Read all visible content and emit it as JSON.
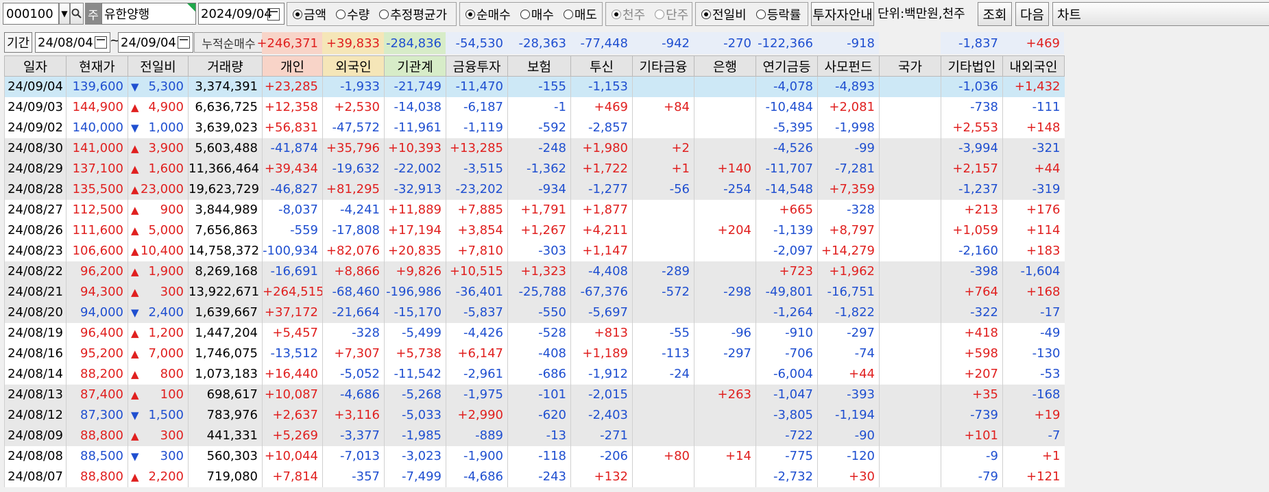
{
  "toolbar": {
    "code": "000100",
    "market_badge": "주",
    "stock_name": "유한양행",
    "date": "2024/09/04",
    "group1": [
      {
        "label": "금액",
        "on": true
      },
      {
        "label": "수량",
        "on": false
      },
      {
        "label": "추정평균가",
        "on": false
      }
    ],
    "group2": [
      {
        "label": "순매수",
        "on": true
      },
      {
        "label": "매수",
        "on": false
      },
      {
        "label": "매도",
        "on": false
      }
    ],
    "group3": [
      {
        "label": "천주",
        "on": true
      },
      {
        "label": "단주",
        "on": false
      }
    ],
    "group4": [
      {
        "label": "전일비",
        "on": true
      },
      {
        "label": "등락률",
        "on": false
      }
    ],
    "investor_btn": "투자자안내",
    "unit": "단위:백만원,천주",
    "search_btn": "조회",
    "next_btn": "다음",
    "chart_btn": "차트"
  },
  "period": {
    "label": "기간",
    "start": "24/08/04",
    "tilde": "~",
    "end": "24/09/04",
    "cum_label": "누적순매수",
    "sums": [
      "+246,371",
      "+39,833",
      "-284,836",
      "-54,530",
      "-28,363",
      "-77,448",
      "-942",
      "-270",
      "-122,366",
      "-918",
      "",
      "-1,837",
      "+469"
    ]
  },
  "columns": [
    "일자",
    "현재가",
    "전일비",
    "거래량",
    "개인",
    "외국인",
    "기관계",
    "금융투자",
    "보험",
    "투신",
    "기타금융",
    "은행",
    "연기금등",
    "사모펀드",
    "국가",
    "기타법인",
    "내외국인"
  ],
  "rows": [
    {
      "d": "24/09/04",
      "p": "139,600",
      "dir": "down",
      "c": "5,300",
      "v": "3,374,391",
      "x": [
        "+23,285",
        "-1,933",
        "-21,749",
        "-11,470",
        "-155",
        "-1,153",
        "",
        "",
        "-4,078",
        "-4,893",
        "",
        "-1,036",
        "+1,432"
      ]
    },
    {
      "d": "24/09/03",
      "p": "144,900",
      "dir": "up",
      "c": "4,900",
      "v": "6,636,725",
      "x": [
        "+12,358",
        "+2,530",
        "-14,038",
        "-6,187",
        "-1",
        "+469",
        "+84",
        "",
        "-10,484",
        "+2,081",
        "",
        "-738",
        "-111"
      ]
    },
    {
      "d": "24/09/02",
      "p": "140,000",
      "dir": "down",
      "c": "1,000",
      "v": "3,639,023",
      "x": [
        "+56,831",
        "-47,572",
        "-11,961",
        "-1,119",
        "-592",
        "-2,857",
        "",
        "",
        "-5,395",
        "-1,998",
        "",
        "+2,553",
        "+148"
      ]
    },
    {
      "d": "24/08/30",
      "p": "141,000",
      "dir": "up",
      "c": "3,900",
      "v": "5,603,488",
      "x": [
        "-41,874",
        "+35,796",
        "+10,393",
        "+13,285",
        "-248",
        "+1,980",
        "+2",
        "",
        "-4,526",
        "-99",
        "",
        "-3,994",
        "-321"
      ]
    },
    {
      "d": "24/08/29",
      "p": "137,100",
      "dir": "up",
      "c": "1,600",
      "v": "11,366,464",
      "x": [
        "+39,434",
        "-19,632",
        "-22,002",
        "-3,515",
        "-1,362",
        "+1,722",
        "+1",
        "+140",
        "-11,707",
        "-7,281",
        "",
        "+2,157",
        "+44"
      ]
    },
    {
      "d": "24/08/28",
      "p": "135,500",
      "dir": "up",
      "c": "23,000",
      "v": "19,623,729",
      "x": [
        "-46,827",
        "+81,295",
        "-32,913",
        "-23,202",
        "-934",
        "-1,277",
        "-56",
        "-254",
        "-14,548",
        "+7,359",
        "",
        "-1,237",
        "-319"
      ]
    },
    {
      "d": "24/08/27",
      "p": "112,500",
      "dir": "up",
      "c": "900",
      "v": "3,844,989",
      "x": [
        "-8,037",
        "-4,241",
        "+11,889",
        "+7,885",
        "+1,791",
        "+1,877",
        "",
        "",
        "+665",
        "-328",
        "",
        "+213",
        "+176"
      ]
    },
    {
      "d": "24/08/26",
      "p": "111,600",
      "dir": "up",
      "c": "5,000",
      "v": "7,656,863",
      "x": [
        "-559",
        "-17,808",
        "+17,194",
        "+3,854",
        "+1,267",
        "+4,211",
        "",
        "+204",
        "-1,139",
        "+8,797",
        "",
        "+1,059",
        "+114"
      ]
    },
    {
      "d": "24/08/23",
      "p": "106,600",
      "dir": "up",
      "c": "10,400",
      "v": "14,758,372",
      "x": [
        "-100,934",
        "+82,076",
        "+20,835",
        "+7,810",
        "-303",
        "+1,147",
        "",
        "",
        "-2,097",
        "+14,279",
        "",
        "-2,160",
        "+183"
      ]
    },
    {
      "d": "24/08/22",
      "p": "96,200",
      "dir": "up",
      "c": "1,900",
      "v": "8,269,168",
      "x": [
        "-16,691",
        "+8,866",
        "+9,826",
        "+10,515",
        "+1,323",
        "-4,408",
        "-289",
        "",
        "+723",
        "+1,962",
        "",
        "-398",
        "-1,604"
      ]
    },
    {
      "d": "24/08/21",
      "p": "94,300",
      "dir": "up",
      "c": "300",
      "v": "13,922,671",
      "x": [
        "+264,515",
        "-68,460",
        "-196,986",
        "-36,401",
        "-25,788",
        "-67,376",
        "-572",
        "-298",
        "-49,801",
        "-16,751",
        "",
        "+764",
        "+168"
      ]
    },
    {
      "d": "24/08/20",
      "p": "94,000",
      "dir": "down",
      "c": "2,400",
      "v": "1,639,667",
      "x": [
        "+37,172",
        "-21,664",
        "-15,170",
        "-5,837",
        "-550",
        "-5,697",
        "",
        "",
        "-1,264",
        "-1,822",
        "",
        "-322",
        "-17"
      ]
    },
    {
      "d": "24/08/19",
      "p": "96,400",
      "dir": "up",
      "c": "1,200",
      "v": "1,447,204",
      "x": [
        "+5,457",
        "-328",
        "-5,499",
        "-4,426",
        "-528",
        "+813",
        "-55",
        "-96",
        "-910",
        "-297",
        "",
        "+418",
        "-49"
      ]
    },
    {
      "d": "24/08/16",
      "p": "95,200",
      "dir": "up",
      "c": "7,000",
      "v": "1,746,075",
      "x": [
        "-13,512",
        "+7,307",
        "+5,738",
        "+6,147",
        "-408",
        "+1,189",
        "-113",
        "-297",
        "-706",
        "-74",
        "",
        "+598",
        "-130"
      ]
    },
    {
      "d": "24/08/14",
      "p": "88,200",
      "dir": "up",
      "c": "800",
      "v": "1,073,183",
      "x": [
        "+16,440",
        "-5,052",
        "-11,542",
        "-2,961",
        "-686",
        "-1,912",
        "-24",
        "",
        "-6,004",
        "+44",
        "",
        "+207",
        "-53"
      ]
    },
    {
      "d": "24/08/13",
      "p": "87,400",
      "dir": "up",
      "c": "100",
      "v": "698,617",
      "x": [
        "+10,087",
        "-4,686",
        "-5,268",
        "-1,975",
        "-101",
        "-2,015",
        "",
        "+263",
        "-1,047",
        "-393",
        "",
        "+35",
        "-168"
      ]
    },
    {
      "d": "24/08/12",
      "p": "87,300",
      "dir": "down",
      "c": "1,500",
      "v": "783,976",
      "x": [
        "+2,637",
        "+3,116",
        "-5,033",
        "+2,990",
        "-620",
        "-2,403",
        "",
        "",
        "-3,805",
        "-1,194",
        "",
        "-739",
        "+19"
      ]
    },
    {
      "d": "24/08/09",
      "p": "88,800",
      "dir": "up",
      "c": "300",
      "v": "441,331",
      "x": [
        "+5,269",
        "-3,377",
        "-1,985",
        "-889",
        "-13",
        "-271",
        "",
        "",
        "-722",
        "-90",
        "",
        "+101",
        "-7"
      ]
    },
    {
      "d": "24/08/08",
      "p": "88,500",
      "dir": "down",
      "c": "300",
      "v": "560,303",
      "x": [
        "+10,044",
        "-7,013",
        "-3,023",
        "-1,900",
        "-118",
        "-206",
        "+80",
        "+14",
        "-775",
        "-120",
        "",
        "-9",
        "+1"
      ]
    },
    {
      "d": "24/08/07",
      "p": "88,800",
      "dir": "up",
      "c": "2,200",
      "v": "719,080",
      "x": [
        "+7,814",
        "-357",
        "-7,499",
        "-4,686",
        "-243",
        "+132",
        "",
        "",
        "-2,732",
        "+30",
        "",
        "-79",
        "+121"
      ]
    }
  ],
  "colors": {
    "up": "#e0201f",
    "down": "#1f4fd0",
    "highlight": "#cde8f6",
    "header_individual": "#f8d4c8",
    "header_foreign": "#f5e6b8",
    "header_inst": "#d7ecc8"
  }
}
